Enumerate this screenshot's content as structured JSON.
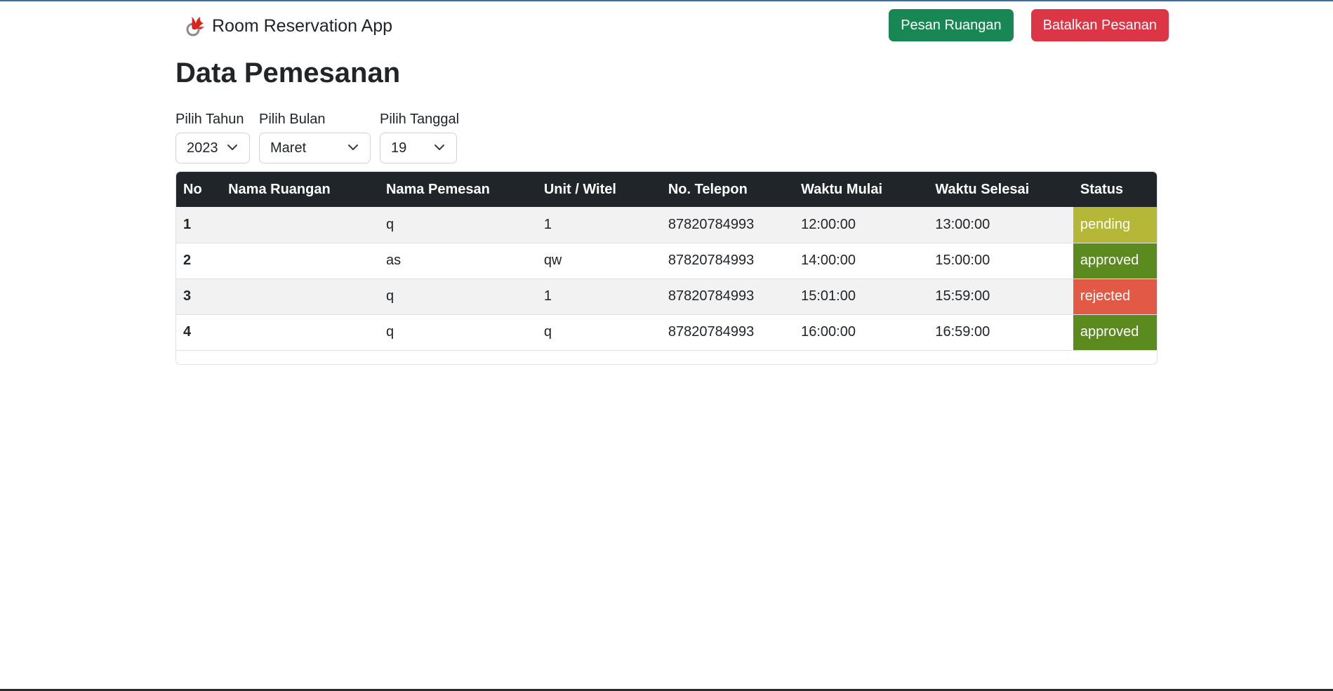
{
  "app": {
    "brand_title": "Room Reservation App"
  },
  "nav": {
    "book_button": "Pesan Ruangan",
    "cancel_button": "Batalkan Pesanan"
  },
  "page": {
    "title": "Data Pemesanan"
  },
  "filters": {
    "year_label": "Pilih Tahun",
    "year_value": "2023",
    "month_label": "Pilih Bulan",
    "month_value": "Maret",
    "day_label": "Pilih Tanggal",
    "day_value": "19"
  },
  "table": {
    "headers": [
      "No",
      "Nama Ruangan",
      "Nama Pemesan",
      "Unit / Witel",
      "No. Telepon",
      "Waktu Mulai",
      "Waktu Selesai",
      "Status"
    ],
    "rows": [
      {
        "no": "1",
        "ruangan": "",
        "pemesan": "q",
        "unit": "1",
        "telepon": "87820784993",
        "mulai": "12:00:00",
        "selesai": "13:00:00",
        "status": "pending"
      },
      {
        "no": "2",
        "ruangan": "",
        "pemesan": "as",
        "unit": "qw",
        "telepon": "87820784993",
        "mulai": "14:00:00",
        "selesai": "15:00:00",
        "status": "approved"
      },
      {
        "no": "3",
        "ruangan": "",
        "pemesan": "q",
        "unit": "1",
        "telepon": "87820784993",
        "mulai": "15:01:00",
        "selesai": "15:59:00",
        "status": "rejected"
      },
      {
        "no": "4",
        "ruangan": "",
        "pemesan": "q",
        "unit": "q",
        "telepon": "87820784993",
        "mulai": "16:00:00",
        "selesai": "16:59:00",
        "status": "approved"
      }
    ]
  },
  "colors": {
    "header_bg": "#212529",
    "success": "#198754",
    "danger": "#dc3545",
    "status_pending": "#b5b736",
    "status_approved": "#5b8a1e",
    "status_rejected": "#e25a45"
  }
}
